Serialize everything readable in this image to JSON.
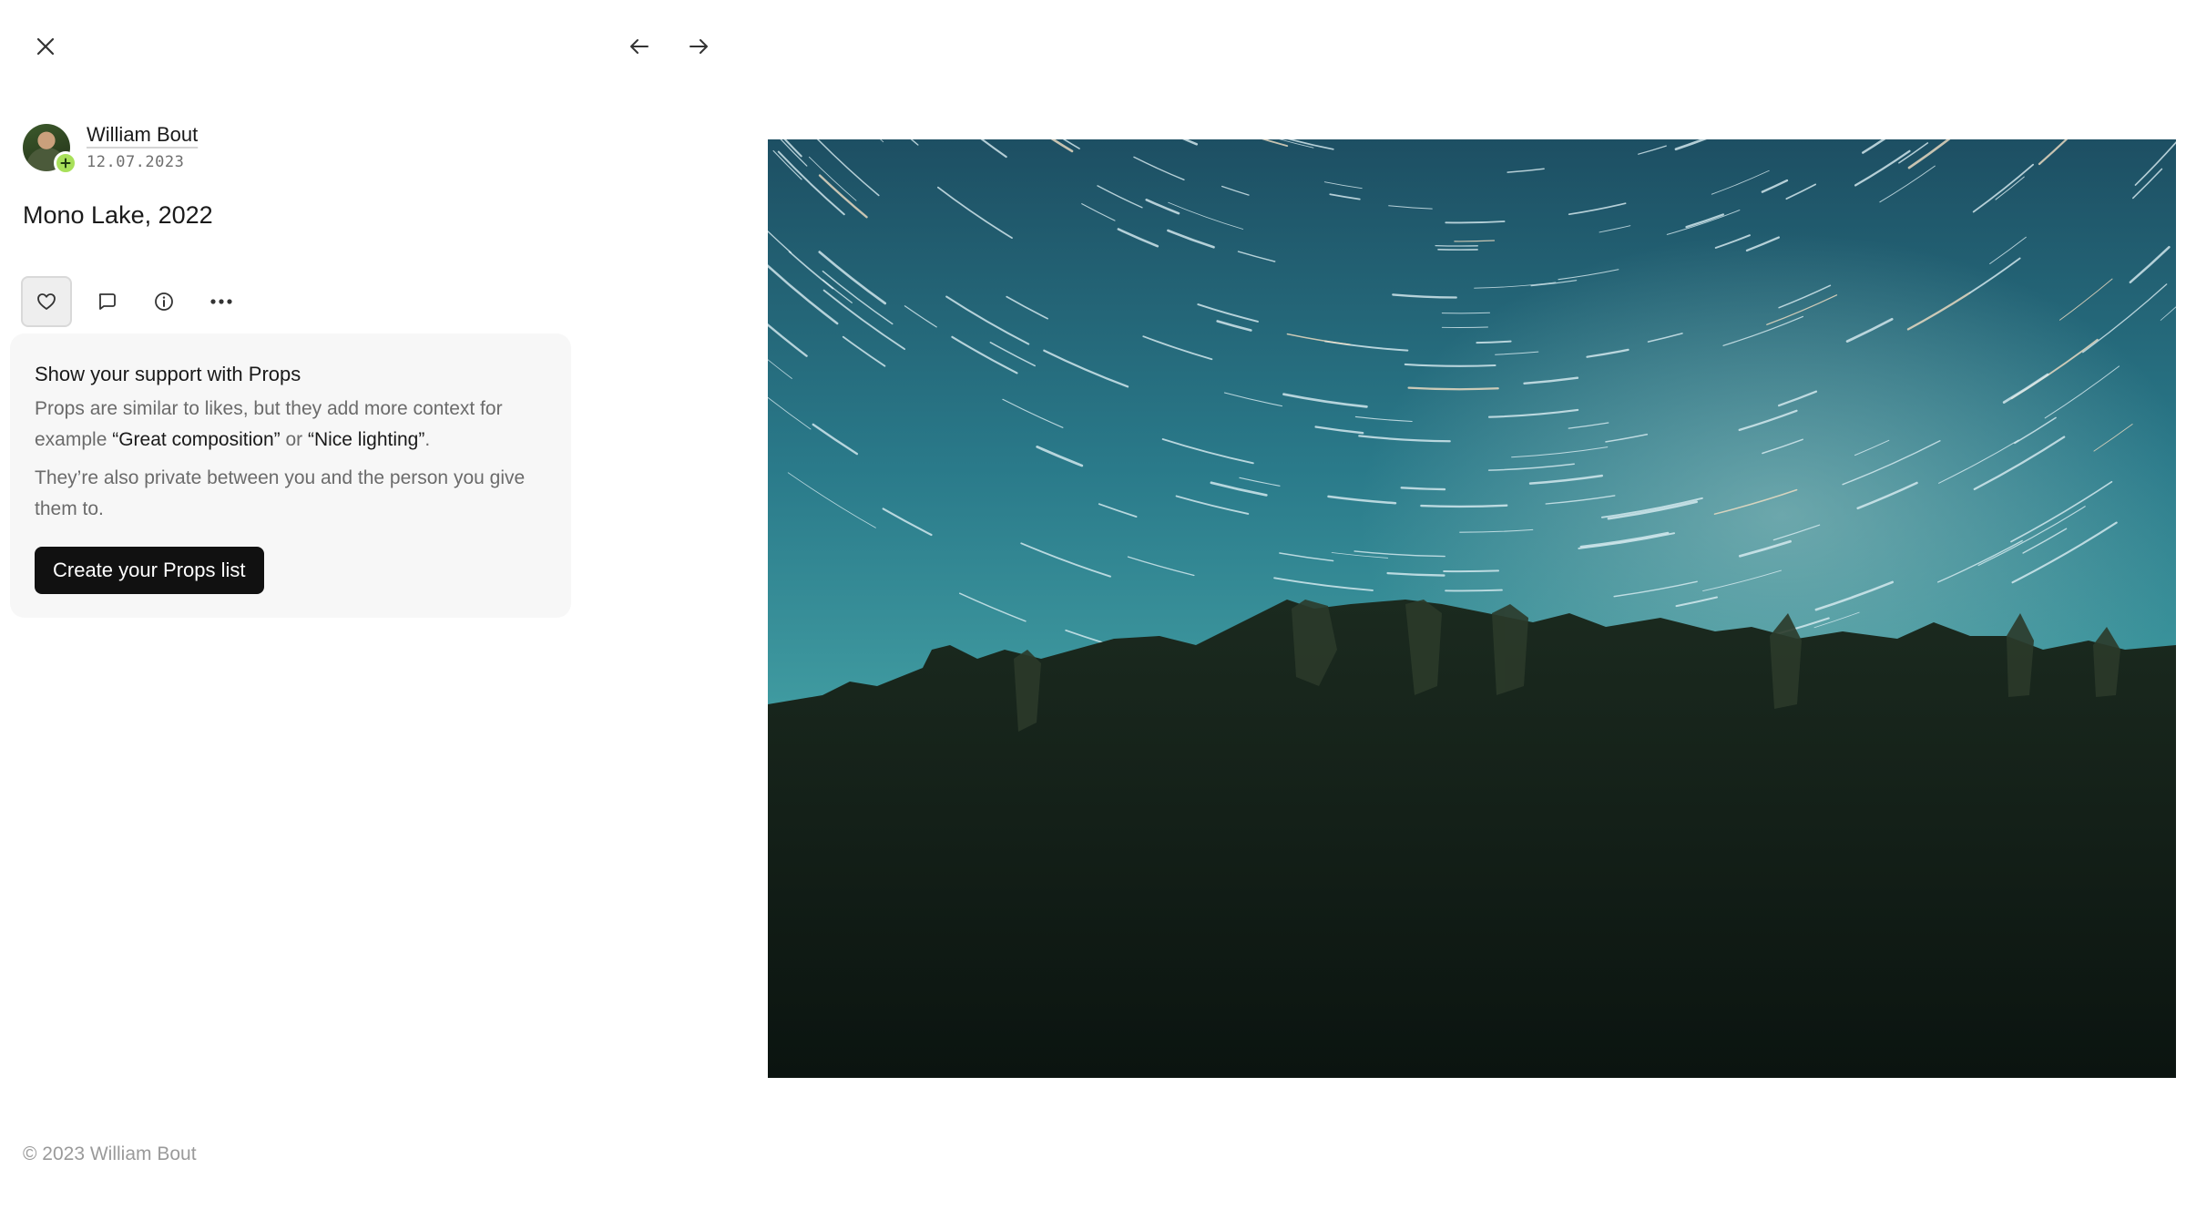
{
  "nav": {
    "close_icon": "close-icon",
    "prev_icon": "arrow-left-icon",
    "next_icon": "arrow-right-icon"
  },
  "author": {
    "name": "William Bout",
    "date": "12.07.2023",
    "badge_color": "#a8e05a"
  },
  "photo": {
    "title": "Mono Lake, 2022"
  },
  "actions": {
    "like_icon": "heart-icon",
    "comment_icon": "comment-icon",
    "info_icon": "info-icon",
    "more_icon": "more-icon"
  },
  "props_card": {
    "title": "Show your support with Props",
    "text_lead": "Props are similar to likes, but they add more context for example ",
    "example_one": "“Great composition”",
    "text_or": " or ",
    "example_two": "“Nice lighting”",
    "text_end": ".",
    "text_private": "They’re also private between you and the person you give them to.",
    "cta_label": "Create your Props list"
  },
  "footer": {
    "copyright": "© 2023 William Bout"
  }
}
